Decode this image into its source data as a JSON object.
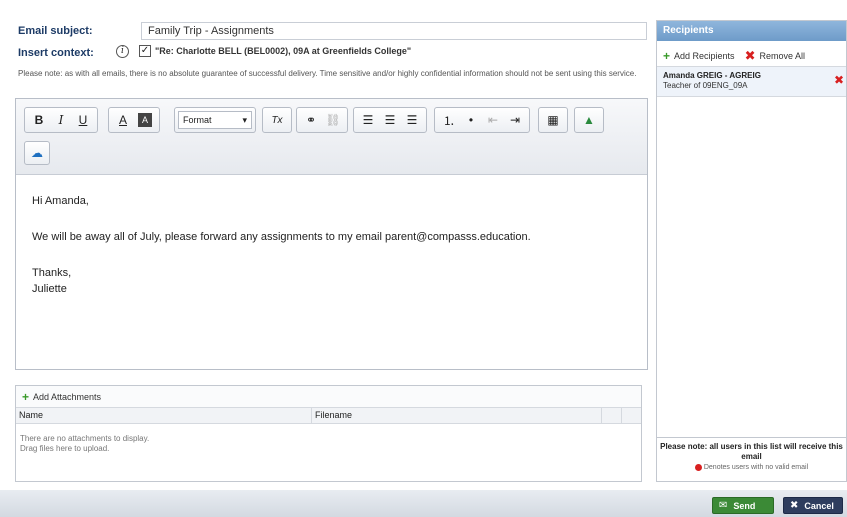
{
  "subject": {
    "label": "Email subject:",
    "value": "Family Trip - Assignments"
  },
  "context": {
    "label": "Insert context:",
    "info_icon": "i",
    "checked": "✓",
    "text": "\"Re: Charlotte BELL (BEL0002), 09A at Greenfields College\""
  },
  "note": "Please note: as with all emails, there is no absolute guarantee of successful delivery. Time sensitive and/or highly confidential information should not be sent using this service.",
  "toolbar": {
    "bold": "B",
    "italic": "I",
    "underline": "U",
    "text_color": "A",
    "bg_color": "A",
    "format_label": "Format",
    "format_arrow": "▾",
    "clear_format": "Tx",
    "link": "⚭",
    "unlink": "⛓",
    "align_left": "☰",
    "align_center": "☰",
    "align_right": "☰",
    "numbered_list": "⒈",
    "bulleted_list": "•",
    "outdent": "⇤",
    "indent": "⇥",
    "table": "▦",
    "drive": "▲",
    "onedrive": "☁"
  },
  "body": {
    "greeting": "Hi Amanda,",
    "line": "We will be away all of July, please forward any assignments to my email parent@compasss.education.",
    "closing": "Thanks,",
    "signature": "Juliette"
  },
  "attachments": {
    "add_label": "Add Attachments",
    "columns": [
      "Name",
      "Filename",
      "",
      ""
    ],
    "empty_1": "There are no attachments to display.",
    "empty_2": "Drag files here to upload."
  },
  "recipients": {
    "title": "Recipients",
    "add_label": "Add Recipients",
    "remove_all_label": "Remove All",
    "items": [
      {
        "name": "Amanda GREIG - AGREIG",
        "role": "Teacher of 09ENG_09A"
      }
    ],
    "footer_bold": "Please note: all users in this list will receive this email",
    "footer_legend": "Denotes users with no valid email"
  },
  "actions": {
    "send": "Send",
    "cancel": "Cancel"
  }
}
